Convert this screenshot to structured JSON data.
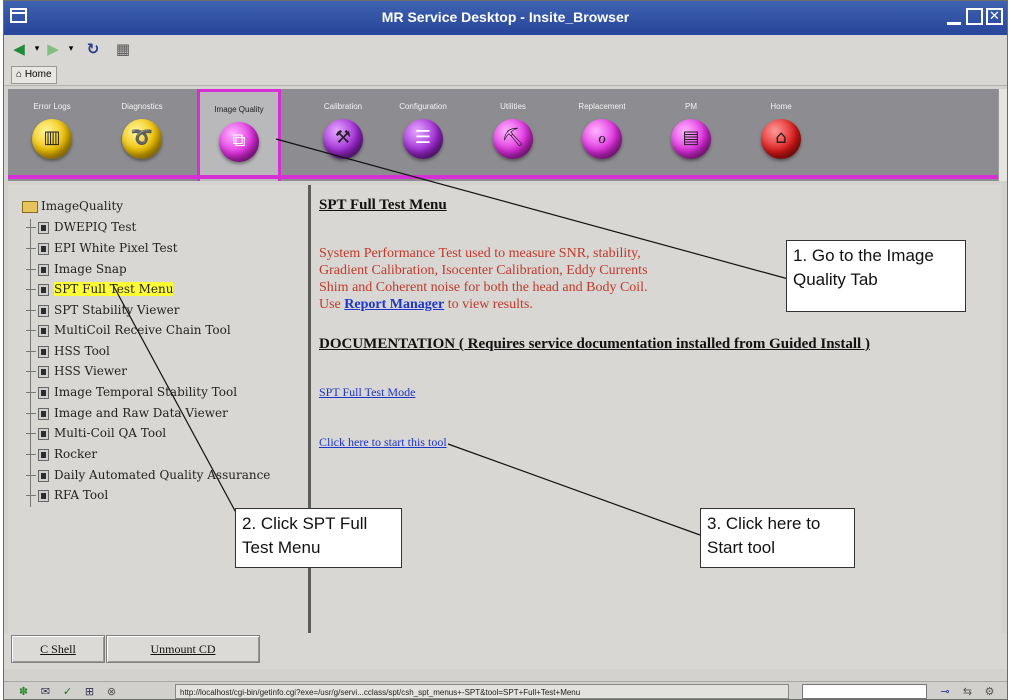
{
  "window": {
    "title": "MR Service Desktop - Insite_Browser"
  },
  "toolbar": {
    "icons": [
      "back-icon",
      "forward-icon",
      "reload-icon",
      "print-icon"
    ]
  },
  "homebar": {
    "home_label": "Home"
  },
  "tabs": [
    {
      "label": "Error Logs",
      "icon": "error-logs-icon",
      "color": "#f2c200"
    },
    {
      "label": "Diagnostics",
      "icon": "stethoscope-icon",
      "color": "#f2c200"
    },
    {
      "label": "Image Quality",
      "icon": "image-quality-icon",
      "color": "#e02fe0"
    },
    {
      "label": "Calibration",
      "icon": "calibration-icon",
      "color": "#a22cd6"
    },
    {
      "label": "Configuration",
      "icon": "configuration-icon",
      "color": "#a22cd6"
    },
    {
      "label": "Utilities",
      "icon": "utilities-icon",
      "color": "#e02fe0"
    },
    {
      "label": "Replacement",
      "icon": "replacement-icon",
      "color": "#e02fe0"
    },
    {
      "label": "PM",
      "icon": "pm-icon",
      "color": "#e02fe0"
    },
    {
      "label": "Home",
      "icon": "home-icon",
      "color": "#e01c1c"
    }
  ],
  "tree": {
    "root": "ImageQuality",
    "items": [
      "DWEPIQ Test",
      "EPI White Pixel Test",
      "Image Snap",
      "SPT Full Test Menu",
      "SPT Stability Viewer",
      "MultiCoil Receive Chain Tool",
      "HSS Tool",
      "HSS Viewer",
      "Image Temporal Stability Tool",
      "Image and Raw Data Viewer",
      "Multi-Coil QA Tool",
      "Rocker",
      "Daily Automated Quality Assurance",
      "RFA Tool"
    ],
    "selected_index": 3
  },
  "content": {
    "heading": "SPT Full Test Menu",
    "desc_line1": "System Performance Test used to measure SNR, stability,",
    "desc_line2": "Gradient Calibration, Isocenter Calibration, Eddy Currents",
    "desc_line3": "Shim and Coherent noise for both the head and Body Coil.",
    "desc_use": "Use",
    "desc_link": "Report Manager",
    "desc_tail": "to view results.",
    "doc_heading": "DOCUMENTATION ( Requires service documentation installed from Guided Install )",
    "link_mode": "SPT Full Test Mode",
    "link_start": "Click here to start this tool"
  },
  "buttons": {
    "cshell": "C Shell",
    "unmount": "Unmount CD"
  },
  "statusbar": {
    "url": "http://localhost/cgi-bin/getinfo.cgi?exe=/usr/g/servi...cclass/spt/csh_spt_menus+-SPT&tool=SPT+Full+Test+Menu"
  },
  "callouts": {
    "c1": "1. Go to the Image Quality   Tab",
    "c2": "2. Click SPT Full Test Menu",
    "c3": "3. Click here to Start tool"
  }
}
